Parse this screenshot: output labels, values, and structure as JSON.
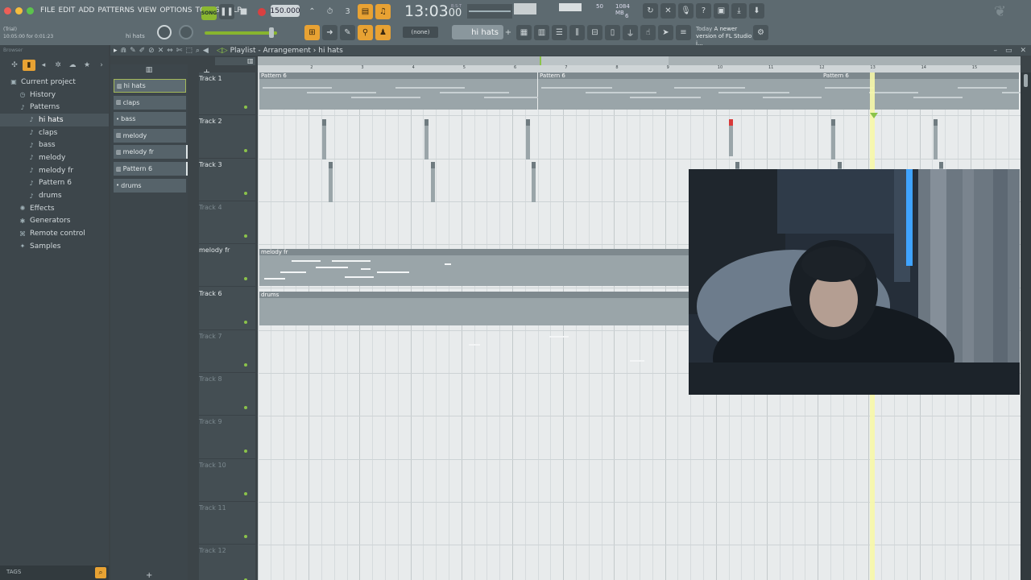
{
  "window": {
    "traffic_colors": [
      "#ed5f57",
      "#f5bd3e",
      "#5cc34d"
    ]
  },
  "menu": [
    "FILE",
    "EDIT",
    "ADD",
    "PATTERNS",
    "VIEW",
    "OPTIONS",
    "TOOLS",
    "HELP"
  ],
  "transport": {
    "mode": "SONG",
    "tempo": "150.000",
    "time": "13:03",
    "time_sub": "00",
    "bst": "B:S:T"
  },
  "cpu": {
    "value": "50",
    "memory": "1084 MB",
    "voices": "6"
  },
  "hint_bar": {
    "trial": "(Trial)",
    "position": "10:05:00 for 0:01:23",
    "selected": "hi hats"
  },
  "pattern_selector": {
    "none_label": "(none)",
    "current": "hi hats"
  },
  "news": {
    "when": "Today",
    "text": "A newer version of FL Studio i..."
  },
  "browser": {
    "title": "Browser",
    "items": [
      {
        "label": "Current project",
        "icon": "folder-icon",
        "indent": 0
      },
      {
        "label": "History",
        "icon": "history-icon",
        "indent": 1
      },
      {
        "label": "Patterns",
        "icon": "note-icon",
        "indent": 1
      },
      {
        "label": "hi hats",
        "icon": "note-icon",
        "indent": 2,
        "selected": true
      },
      {
        "label": "claps",
        "icon": "note-icon",
        "indent": 2
      },
      {
        "label": "bass",
        "icon": "note-icon",
        "indent": 2
      },
      {
        "label": "melody",
        "icon": "note-icon",
        "indent": 2
      },
      {
        "label": "melody fr",
        "icon": "note-icon",
        "indent": 2
      },
      {
        "label": "Pattern 6",
        "icon": "note-icon",
        "indent": 2
      },
      {
        "label": "drums",
        "icon": "note-icon",
        "indent": 2
      },
      {
        "label": "Effects",
        "icon": "effects-icon",
        "indent": 1
      },
      {
        "label": "Generators",
        "icon": "generators-icon",
        "indent": 1
      },
      {
        "label": "Remote control",
        "icon": "remote-icon",
        "indent": 1
      },
      {
        "label": "Samples",
        "icon": "samples-icon",
        "indent": 1
      }
    ],
    "tags_label": "TAGS"
  },
  "playlist": {
    "title": "Playlist - Arrangement",
    "pattern": "hi hats",
    "patterns": [
      {
        "label": "hi hats",
        "selected": true
      },
      {
        "label": "claps"
      },
      {
        "label": "bass"
      },
      {
        "label": "melody"
      },
      {
        "label": "melody fr",
        "bar": true
      },
      {
        "label": "Pattern 6",
        "bar": true
      },
      {
        "label": "drums"
      }
    ],
    "tracks": [
      "Track 1",
      "Track 2",
      "Track 3",
      "Track 4",
      "melody fr",
      "Track 6",
      "Track 7",
      "Track 8",
      "Track 9",
      "Track 10",
      "Track 11",
      "Track 12"
    ],
    "ruler": [
      "2",
      "3",
      "4",
      "5",
      "6",
      "7",
      "8",
      "9",
      "10",
      "11",
      "12",
      "13",
      "14",
      "15"
    ],
    "clips": {
      "pattern6": "Pattern 6",
      "melody": "melody fr",
      "drums": "drums"
    }
  }
}
